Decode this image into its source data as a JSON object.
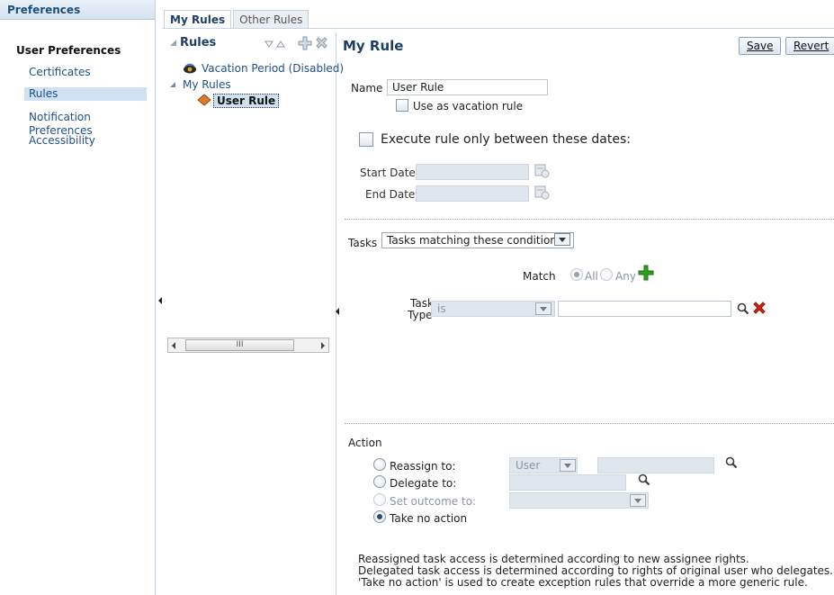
{
  "sidebar": {
    "title": "Preferences",
    "group": "User Preferences",
    "items": [
      {
        "label": "Certificates",
        "selected": false
      },
      {
        "label": "Rules",
        "selected": true
      },
      {
        "label": "Notification Preferences",
        "selected": false
      },
      {
        "label": "Accessibility",
        "selected": false
      }
    ]
  },
  "tabs": [
    {
      "label": "My Rules",
      "active": true
    },
    {
      "label": "Other Rules",
      "active": false
    }
  ],
  "rules_panel": {
    "title": "Rules",
    "tree": {
      "vacation": "Vacation Period (Disabled)",
      "my_rules": "My Rules",
      "user_rule": "User Rule"
    },
    "scroll_grip": "III"
  },
  "form": {
    "title": "My Rule",
    "save_label": "Save",
    "revert_label": "Revert",
    "name_label": "Name",
    "name_value": "User Rule",
    "vacation_label": "Use as vacation rule",
    "execute_label": "Execute rule only between these dates:",
    "start_label": "Start Date",
    "end_label": "End Date",
    "tasks_label": "Tasks",
    "tasks_value": "Tasks matching these conditions",
    "match_label": "Match",
    "match_all": "All",
    "match_any": "Any",
    "task_type_label_1": "Task",
    "task_type_label_2": "Type",
    "task_type_op": "is",
    "action_label": "Action",
    "reassign_label": "Reassign to:",
    "reassign_type": "User",
    "delegate_label": "Delegate to:",
    "outcome_label": "Set outcome to:",
    "no_action_label": "Take no action",
    "note_1": "Reassigned task access is determined according to new assignee rights.",
    "note_2": "Delegated task access is determined according to rights of original user who delegates.",
    "note_3": "'Take no action' is used to create exception rules that override a more generic rule."
  },
  "colors": {
    "header_text": "#1d4f7d",
    "link": "#1f4f8c",
    "selection": "#cfe0f1",
    "add_icon": "#2fa11f",
    "delete_icon": "#d42a1a"
  }
}
